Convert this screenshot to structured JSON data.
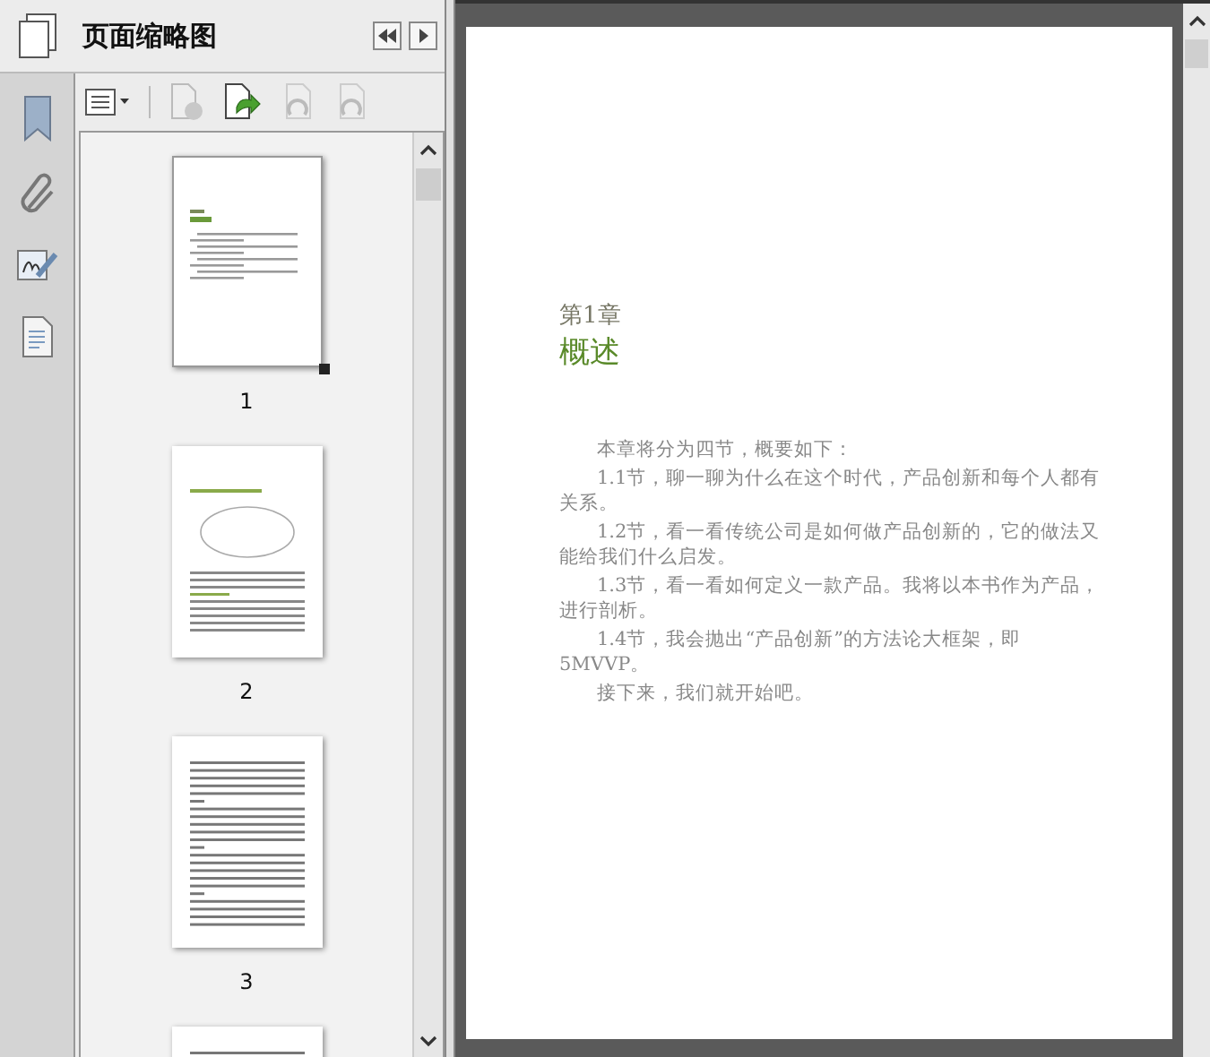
{
  "sidebar": {
    "panel_title": "页面缩略图",
    "thumbnails": [
      {
        "label": "1",
        "kind": "chapter",
        "selected": true
      },
      {
        "label": "2",
        "kind": "figure",
        "selected": false
      },
      {
        "label": "3",
        "kind": "text",
        "selected": false
      },
      {
        "kind": "text",
        "selected": false
      }
    ]
  },
  "page": {
    "chapter": "第1章",
    "title": "概述",
    "paragraphs": [
      "本章将分为四节，概要如下：",
      "1.1节，聊一聊为什么在这个时代，产品创新和每个人都有关系。",
      "1.2节，看一看传统公司是如何做产品创新的，它的做法又能给我们什么启发。",
      "1.3节，看一看如何定义一款产品。我将以本书作为产品，进行剖析。",
      "1.4节，我会抛出“产品创新”的方法论大框架，即5MVVP。",
      "接下来，我们就开始吧。"
    ]
  }
}
